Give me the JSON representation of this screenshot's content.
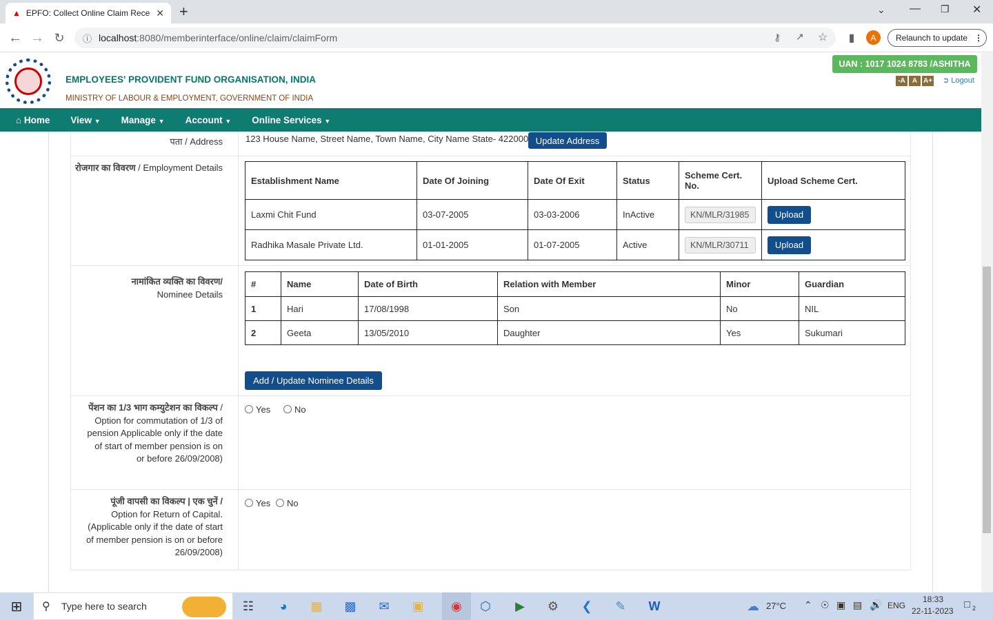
{
  "browser": {
    "tab_title": "EPFO: Collect Online Claim Rece",
    "new_tab": "+",
    "url_host": "localhost",
    "url_rest": ":8080/memberinterface/online/claim/claimForm",
    "relaunch_label": "Relaunch to update",
    "profile_initial": "A"
  },
  "header": {
    "org_name": "EMPLOYEES' PROVIDENT FUND ORGANISATION, INDIA",
    "ministry": "MINISTRY OF LABOUR & EMPLOYMENT, GOVERNMENT OF INDIA",
    "uan": "UAN : 1017 1024 8783 /ASHITHA",
    "font_small": "-A",
    "font_normal": "A",
    "font_large": "A+",
    "logout": "Logout"
  },
  "nav": {
    "home": "Home",
    "view": "View",
    "manage": "Manage",
    "account": "Account",
    "online_services": "Online Services"
  },
  "address": {
    "label": "पता / Address",
    "value": "123 House Name, Street Name, Town Name, City Name State- 422000",
    "button": "Update Address"
  },
  "employment": {
    "label_hi": "रोजगार का विवरण",
    "label_en": "/ Employment Details",
    "headers": [
      "Establishment Name",
      "Date Of Joining",
      "Date Of Exit",
      "Status",
      "Scheme Cert. No.",
      "Upload Scheme Cert."
    ],
    "rows": [
      {
        "name": "Laxmi Chit Fund",
        "doj": "03-07-2005",
        "doe": "03-03-2006",
        "status": "InActive",
        "cert": "KN/MLR/31985",
        "upload": "Upload"
      },
      {
        "name": "Radhika Masale Private Ltd.",
        "doj": "01-01-2005",
        "doe": "01-07-2005",
        "status": "Active",
        "cert": "KN/MLR/30711",
        "upload": "Upload"
      }
    ]
  },
  "nominee": {
    "label_hi": "नामांकित व्यक्ति का विवरण/",
    "label_en": "Nominee Details",
    "headers": [
      "#",
      "Name",
      "Date of Birth",
      "Relation with Member",
      "Minor",
      "Guardian"
    ],
    "rows": [
      {
        "no": "1",
        "name": "Hari",
        "dob": "17/08/1998",
        "relation": "Son",
        "minor": "No",
        "guardian": "NIL"
      },
      {
        "no": "2",
        "name": "Geeta",
        "dob": "13/05/2010",
        "relation": "Daughter",
        "minor": "Yes",
        "guardian": "Sukumari"
      }
    ],
    "button": "Add / Update Nominee Details"
  },
  "commutation": {
    "label_hi": "पेंशन का 1/3 भाग कम्युटेशन का विकल्प",
    "label_en": "/ Option for commutation of 1/3 of pension",
    "note": "Applicable only if the date of start of member pension is on or before 26/09/2008)",
    "yes": "Yes",
    "no": "No"
  },
  "return_capital": {
    "label_hi": "पूंजी वापसी का विकल्प | एक चुनें /",
    "label_en": "Option for Return of Capital.",
    "note": "(Applicable only if the date of start of member pension is on or before 26/09/2008)",
    "yes": "Yes",
    "no": "No"
  },
  "taskbar": {
    "search_placeholder": "Type here to search",
    "temperature": "27°C",
    "language": "ENG",
    "time": "18:33",
    "date": "22-11-2023",
    "notifications": "2"
  },
  "colors": {
    "nav_teal": "#0f7c72",
    "button_blue": "#124e8c",
    "uan_green": "#5cb85c"
  }
}
